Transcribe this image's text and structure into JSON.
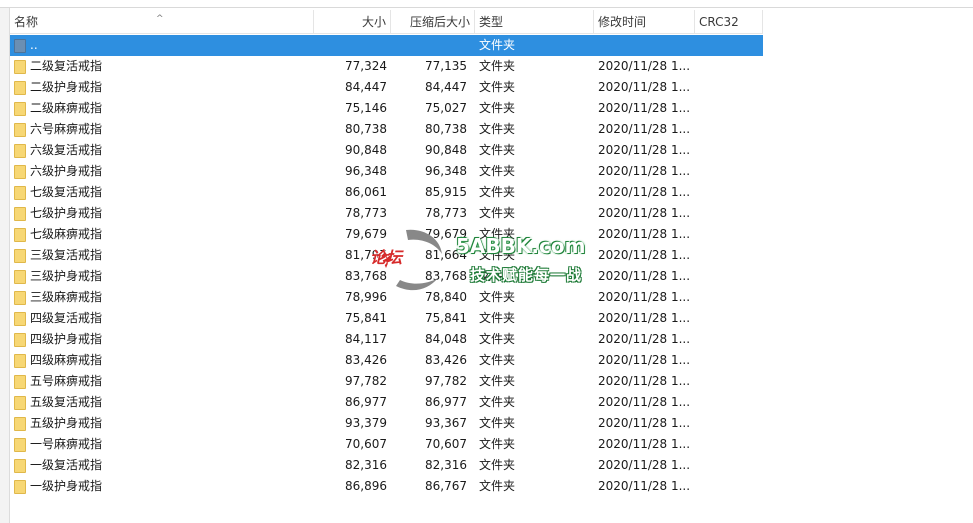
{
  "columns": {
    "name": "名称",
    "size": "大小",
    "packed": "压缩后大小",
    "type": "类型",
    "modified": "修改时间",
    "crc": "CRC32"
  },
  "parent_row": {
    "name": "..",
    "type": "文件夹"
  },
  "rows": [
    {
      "name": "二级复活戒指",
      "size": "77,324",
      "packed": "77,135",
      "type": "文件夹",
      "modified": "2020/11/28 1..."
    },
    {
      "name": "二级护身戒指",
      "size": "84,447",
      "packed": "84,447",
      "type": "文件夹",
      "modified": "2020/11/28 1..."
    },
    {
      "name": "二级麻痹戒指",
      "size": "75,146",
      "packed": "75,027",
      "type": "文件夹",
      "modified": "2020/11/28 1..."
    },
    {
      "name": "六号麻痹戒指",
      "size": "80,738",
      "packed": "80,738",
      "type": "文件夹",
      "modified": "2020/11/28 1..."
    },
    {
      "name": "六级复活戒指",
      "size": "90,848",
      "packed": "90,848",
      "type": "文件夹",
      "modified": "2020/11/28 1..."
    },
    {
      "name": "六级护身戒指",
      "size": "96,348",
      "packed": "96,348",
      "type": "文件夹",
      "modified": "2020/11/28 1..."
    },
    {
      "name": "七级复活戒指",
      "size": "86,061",
      "packed": "85,915",
      "type": "文件夹",
      "modified": "2020/11/28 1..."
    },
    {
      "name": "七级护身戒指",
      "size": "78,773",
      "packed": "78,773",
      "type": "文件夹",
      "modified": "2020/11/28 1..."
    },
    {
      "name": "七级麻痹戒指",
      "size": "79,679",
      "packed": "79,679",
      "type": "文件夹",
      "modified": "2020/11/28 1..."
    },
    {
      "name": "三级复活戒指",
      "size": "81,797",
      "packed": "81,664",
      "type": "文件夹",
      "modified": "2020/11/28 1..."
    },
    {
      "name": "三级护身戒指",
      "size": "83,768",
      "packed": "83,768",
      "type": "文件夹",
      "modified": "2020/11/28 1..."
    },
    {
      "name": "三级麻痹戒指",
      "size": "78,996",
      "packed": "78,840",
      "type": "文件夹",
      "modified": "2020/11/28 1..."
    },
    {
      "name": "四级复活戒指",
      "size": "75,841",
      "packed": "75,841",
      "type": "文件夹",
      "modified": "2020/11/28 1..."
    },
    {
      "name": "四级护身戒指",
      "size": "84,117",
      "packed": "84,048",
      "type": "文件夹",
      "modified": "2020/11/28 1..."
    },
    {
      "name": "四级麻痹戒指",
      "size": "83,426",
      "packed": "83,426",
      "type": "文件夹",
      "modified": "2020/11/28 1..."
    },
    {
      "name": "五号麻痹戒指",
      "size": "97,782",
      "packed": "97,782",
      "type": "文件夹",
      "modified": "2020/11/28 1..."
    },
    {
      "name": "五级复活戒指",
      "size": "86,977",
      "packed": "86,977",
      "type": "文件夹",
      "modified": "2020/11/28 1..."
    },
    {
      "name": "五级护身戒指",
      "size": "93,379",
      "packed": "93,367",
      "type": "文件夹",
      "modified": "2020/11/28 1..."
    },
    {
      "name": "一号麻痹戒指",
      "size": "70,607",
      "packed": "70,607",
      "type": "文件夹",
      "modified": "2020/11/28 1..."
    },
    {
      "name": "一级复活戒指",
      "size": "82,316",
      "packed": "82,316",
      "type": "文件夹",
      "modified": "2020/11/28 1..."
    },
    {
      "name": "一级护身戒指",
      "size": "86,896",
      "packed": "86,767",
      "type": "文件夹",
      "modified": "2020/11/28 1..."
    }
  ],
  "watermark": {
    "site": "5ABBK.com",
    "slogan": "技术赋能每一战",
    "logo_text": "论坛"
  },
  "colors": {
    "selection": "#2e8fe0",
    "folder": "#f7d774"
  },
  "icons": {
    "folder": "folder-icon",
    "parent": "parent-folder-icon",
    "sort": "sort-ascending-icon"
  }
}
